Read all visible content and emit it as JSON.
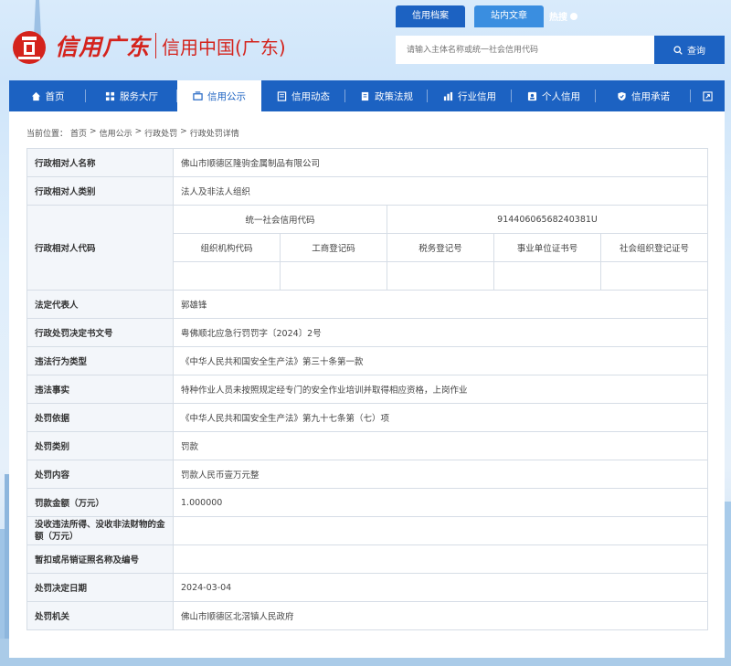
{
  "site": {
    "logo_text": "信用广东",
    "logo_sub": "信用中国(广东)"
  },
  "top_tabs": [
    {
      "label": "信用档案",
      "active": true
    },
    {
      "label": "站内文章",
      "active": false
    }
  ],
  "hot_search": "热搜",
  "search": {
    "placeholder": "请输入主体名称或统一社会信用代码",
    "button_label": "查询"
  },
  "nav": [
    {
      "label": "首页",
      "icon": "home-icon",
      "active": false
    },
    {
      "label": "服务大厅",
      "icon": "grid-icon",
      "active": false
    },
    {
      "label": "信用公示",
      "icon": "notice-icon",
      "active": true
    },
    {
      "label": "信用动态",
      "icon": "news-icon",
      "active": false
    },
    {
      "label": "政策法规",
      "icon": "document-icon",
      "active": false
    },
    {
      "label": "行业信用",
      "icon": "chart-icon",
      "active": false
    },
    {
      "label": "个人信用",
      "icon": "person-icon",
      "active": false
    },
    {
      "label": "信用承诺",
      "icon": "shield-icon",
      "active": false
    }
  ],
  "breadcrumb": {
    "prefix": "当前位置：",
    "items": [
      "首页",
      "信用公示",
      "行政处罚",
      "行政处罚详情"
    ],
    "separator": ">"
  },
  "detail": {
    "subject_name_label": "行政相对人名称",
    "subject_name": "佛山市顺德区隆驹金属制品有限公司",
    "subject_type_label": "行政相对人类别",
    "subject_type": "法人及非法人组织",
    "subject_code_label": "行政相对人代码",
    "uscc_label": "统一社会信用代码",
    "uscc": "91440606568240381U",
    "code_headers": [
      "组织机构代码",
      "工商登记码",
      "税务登记号",
      "事业单位证书号",
      "社会组织登记证号"
    ],
    "code_values": [
      "",
      "",
      "",
      "",
      ""
    ],
    "legal_rep_label": "法定代表人",
    "legal_rep": "郭雄锋",
    "doc_no_label": "行政处罚决定书文号",
    "doc_no": "粤佛顺北应急行罚罚字〔2024〕2号",
    "violation_type_label": "违法行为类型",
    "violation_type": "《中华人民共和国安全生产法》第三十条第一款",
    "facts_label": "违法事实",
    "facts": "特种作业人员未按照规定经专门的安全作业培训并取得相应资格，上岗作业",
    "basis_label": "处罚依据",
    "basis": "《中华人民共和国安全生产法》第九十七条第（七）项",
    "category_label": "处罚类别",
    "category": "罚款",
    "content_label": "处罚内容",
    "content": "罚款人民币壹万元整",
    "amount_label": "罚款金额（万元）",
    "amount": "1.000000",
    "confiscation_label": "没收违法所得、没收非法财物的金额（万元）",
    "confiscation": "",
    "license_label": "暂扣或吊销证照名称及编号",
    "license": "",
    "date_label": "处罚决定日期",
    "date": "2024-03-04",
    "authority_label": "处罚机关",
    "authority": "佛山市顺德区北滘镇人民政府"
  }
}
